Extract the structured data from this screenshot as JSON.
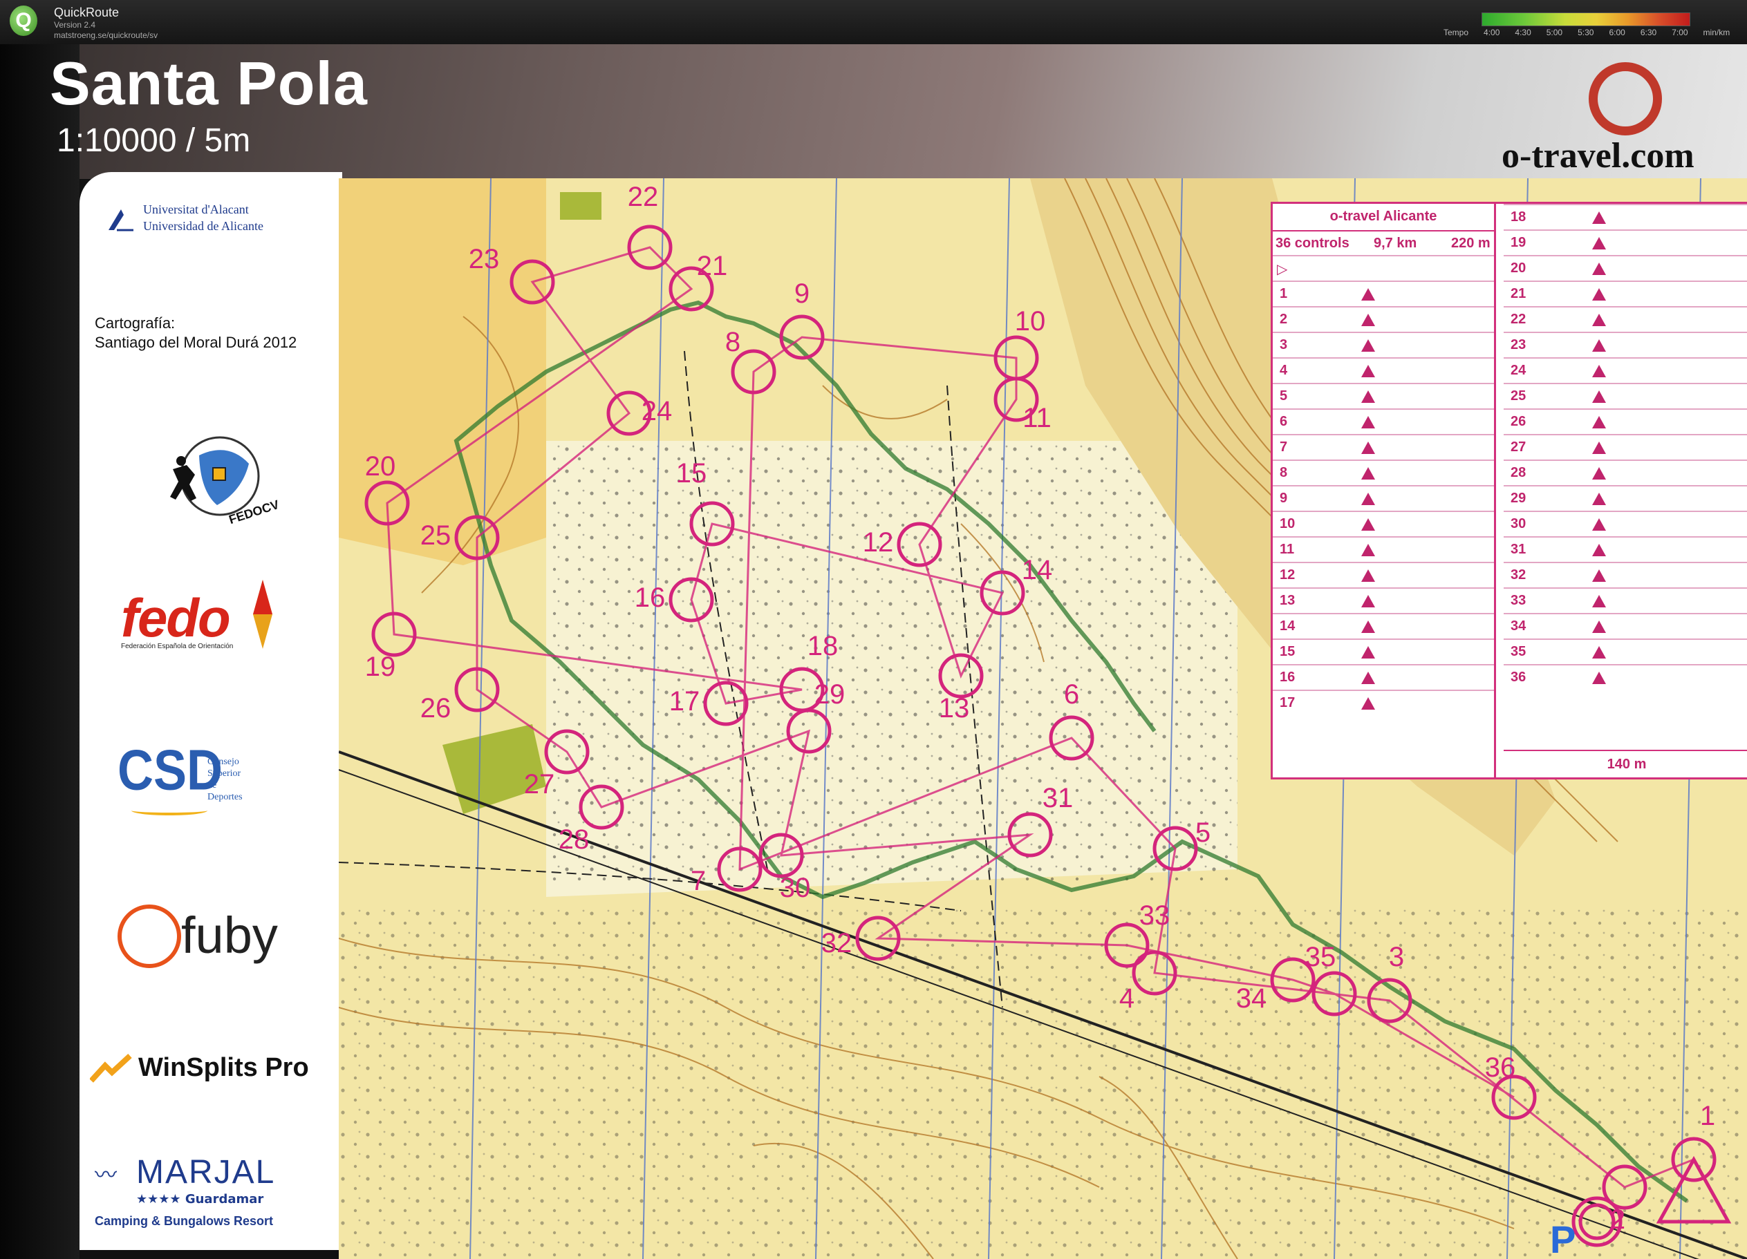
{
  "app": {
    "name": "QuickRoute",
    "version": "Version 2.4",
    "url": "matstroeng.se/quickroute/sv",
    "logo_glyph": "Q"
  },
  "tempo_legend": {
    "label": "Tempo",
    "ticks": [
      "4:00",
      "4:30",
      "5:00",
      "5:30",
      "6:00",
      "6:30",
      "7:00"
    ],
    "unit": "min/km",
    "colors": [
      "#2eaa2e",
      "#c8dc3a",
      "#e89a2a",
      "#c21c1c"
    ]
  },
  "map_sheet": {
    "title": "Santa Pola",
    "scale": "1:10000 / 5m",
    "brand_url": "o-travel.com",
    "cartography_label": "Cartografía:",
    "cartography_credit": "Santiago del Moral Durá 2012",
    "sponsors": {
      "university_line1": "Universitat d'Alacant",
      "university_line2": "Universidad de Alicante",
      "fedocv": "FEDOCV",
      "fedo": "fedo",
      "fedo_full": "Federación Española de Orientación",
      "csd": "CSD",
      "csd_full_1": "Consejo",
      "csd_full_2": "Superior de",
      "csd_full_3": "Deportes",
      "fuby": "fuby",
      "winsplits": "WinSplits Pro",
      "marjal": "MARJAL",
      "marjal_stars": "★★★★",
      "marjal_place": "Guardamar",
      "marjal_sub": "Camping & Bungalows Resort"
    }
  },
  "course": {
    "event": "o-travel Alicante",
    "controls_label": "36 controls",
    "length": "9,7 km",
    "climb": "220 m",
    "finish_distance": "140 m",
    "control_numbers": [
      "1",
      "2",
      "3",
      "4",
      "5",
      "6",
      "7",
      "8",
      "9",
      "10",
      "11",
      "12",
      "13",
      "14",
      "15",
      "16",
      "17",
      "18",
      "19",
      "20",
      "21",
      "22",
      "23",
      "24",
      "25",
      "26",
      "27",
      "28",
      "29",
      "30",
      "31",
      "32",
      "33",
      "34",
      "35",
      "36"
    ],
    "parking_label": "P"
  },
  "colors": {
    "course_magenta": "#d4247c",
    "route_green": "#2f7a2f",
    "map_yellow": "#f4e7a4",
    "map_contour": "#b5792b",
    "brand_red": "#c0392b"
  }
}
